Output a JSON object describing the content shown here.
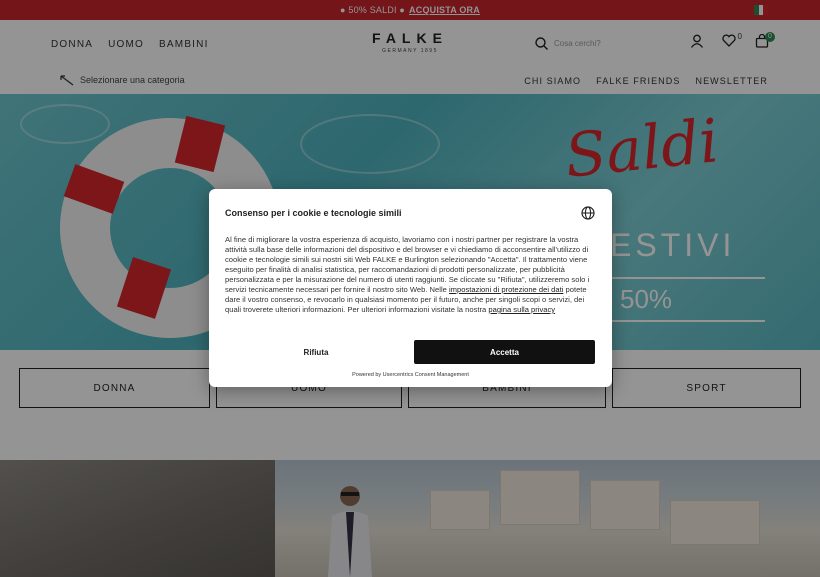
{
  "promo": {
    "text": "● 50% SALDI ●",
    "cta": "ACQUISTA ORA"
  },
  "header": {
    "nav": [
      "DONNA",
      "UOMO",
      "BAMBINI"
    ],
    "logo": "FALKE",
    "logo_sub": "GERMANY 1895",
    "search_placeholder": "Cosa cerchi?",
    "wishlist_count": "0",
    "cart_count": "0"
  },
  "subnav": {
    "category_prompt": "Selezionare una categoria",
    "links": [
      "CHI SIAMO",
      "FALKE FRIENDS",
      "NEWSLETTER"
    ]
  },
  "hero": {
    "script": "Saldi",
    "title": "ESTIVI",
    "discount": "50%"
  },
  "categories": [
    "DONNA",
    "UOMO",
    "BAMBINI",
    "SPORT"
  ],
  "consent": {
    "title": "Consenso per i cookie e tecnologie simili",
    "body_1": "Al fine di migliorare la vostra esperienza di acquisto, lavoriamo con i nostri partner per registrare la vostra attività sulla base delle informazioni del dispositivo e del browser e vi chiediamo di acconsentire all'utilizzo di cookie e tecnologie simili sui nostri siti Web FALKE e Burlington selezionando \"Accetta\". Il trattamento viene eseguito per finalità di analisi statistica, per raccomandazioni di prodotti personalizzate, per pubblicità personalizzata e per la misurazione del numero di utenti raggiunti. Se cliccate su \"Rifiuta\", utilizzeremo solo i servizi tecnicamente necessari per fornire il nostro sito Web. Nelle",
    "link_1": "impostazioni di protezione dei dati",
    "body_2": "potete dare il vostro consenso, e revocarlo in qualsiasi momento per il futuro, anche per singoli scopi o servizi, dei quali troverete ulteriori informazioni. Per ulteriori informazioni visitate la nostra",
    "link_2": "pagina sulla privacy",
    "reject_label": "Rifiuta",
    "accept_label": "Accetta",
    "powered_by": "Powered by Usercentrics Consent Management"
  },
  "colors": {
    "brand_red": "#c6252c",
    "accent_green": "#2d8a52",
    "button_dark": "#111111"
  }
}
